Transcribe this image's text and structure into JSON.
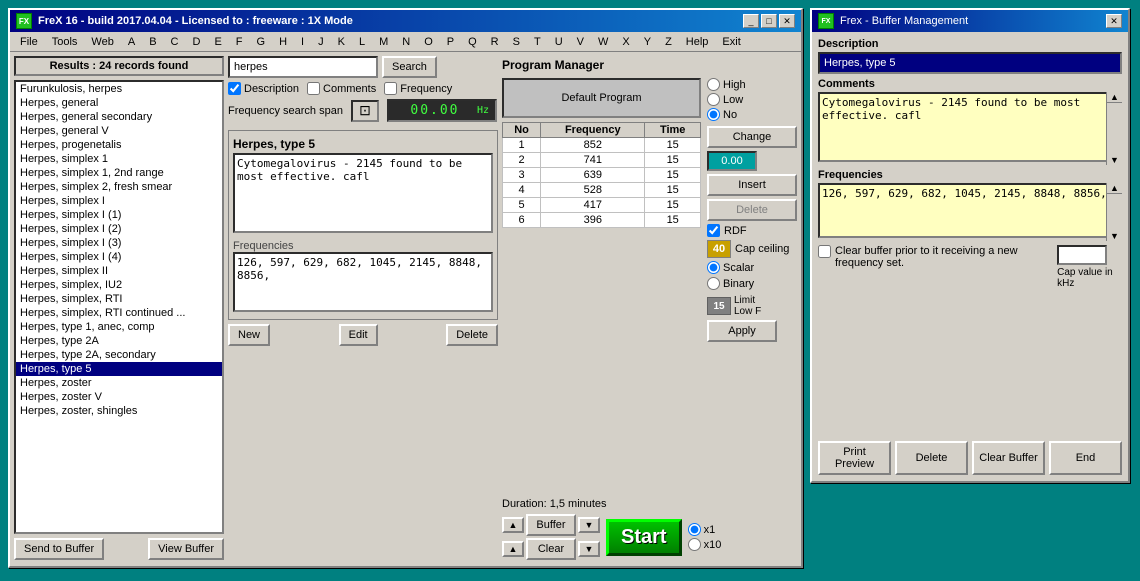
{
  "main_window": {
    "title": "FreX 16 - build 2017.04.04 - Licensed to : freeware  :  1X Mode",
    "icon": "FX",
    "menu_items": [
      "File",
      "Tools",
      "Web",
      "A",
      "B",
      "C",
      "D",
      "E",
      "F",
      "G",
      "H",
      "I",
      "J",
      "K",
      "L",
      "M",
      "N",
      "O",
      "P",
      "Q",
      "R",
      "S",
      "T",
      "U",
      "V",
      "W",
      "X",
      "Y",
      "Z",
      "Help",
      "Exit"
    ]
  },
  "results": {
    "header": "Results : 24 records found",
    "items": [
      "Furunkulosis, herpes",
      "Herpes, general",
      "Herpes, general secondary",
      "Herpes, general V",
      "Herpes, progenetalis",
      "Herpes, simplex 1",
      "Herpes, simplex 1, 2nd range",
      "Herpes, simplex 2, fresh smear",
      "Herpes, simplex I",
      "Herpes, simplex I (1)",
      "Herpes, simplex I (2)",
      "Herpes, simplex I (3)",
      "Herpes, simplex I (4)",
      "Herpes, simplex II",
      "Herpes, simplex, IU2",
      "Herpes, simplex, RTI",
      "Herpes, simplex, RTI continued ...",
      "Herpes, type 1, anec, comp",
      "Herpes, type 2A",
      "Herpes, type 2A, secondary",
      "Herpes, type 5",
      "Herpes, zoster",
      "Herpes, zoster V",
      "Herpes, zoster, shingles"
    ],
    "selected_index": 20,
    "buttons": {
      "send_to_buffer": "Send to Buffer",
      "view_buffer": "View Buffer"
    }
  },
  "search": {
    "input_value": "herpes",
    "button_label": "Search",
    "checkboxes": {
      "description": {
        "label": "Description",
        "checked": true
      },
      "comments": {
        "label": "Comments",
        "checked": false
      },
      "frequency": {
        "label": "Frequency",
        "checked": false
      }
    },
    "freq_span_label": "Frequency search span",
    "freq_display": "00.00",
    "hz_label": "Hz"
  },
  "selected_item": {
    "name": "Herpes, type 5",
    "description": "Cytomegalovirus - 2145 found to be most effective. cafl",
    "frequencies_label": "Frequencies",
    "frequencies": "126, 597, 629, 682, 1045, 2145, 8848, 8856,",
    "buttons": {
      "new": "New",
      "edit": "Edit",
      "delete": "Delete"
    }
  },
  "program_manager": {
    "title": "Program Manager",
    "default_program": "Default Program",
    "table": {
      "headers": [
        "No",
        "Frequency",
        "Time"
      ],
      "rows": [
        [
          "1",
          "852",
          "15"
        ],
        [
          "2",
          "741",
          "15"
        ],
        [
          "3",
          "639",
          "15"
        ],
        [
          "4",
          "528",
          "15"
        ],
        [
          "5",
          "417",
          "15"
        ],
        [
          "6",
          "396",
          "15"
        ]
      ]
    },
    "radio_group": {
      "label_high": "High",
      "label_low": "Low",
      "label_no": "No",
      "selected": "No"
    },
    "change_label": "Change",
    "change_value": "0.00",
    "insert_label": "Insert",
    "delete_label": "Delete",
    "rdf_label": "RDF",
    "rdf_checked": true,
    "cap_ceiling_label": "Cap ceiling",
    "cap_value": "40",
    "scalar_label": "Scalar",
    "binary_label": "Binary",
    "scalar_selected": true,
    "limit_label": "Limit",
    "low_f_label": "Low F",
    "limit_value": "15",
    "apply_label": "Apply",
    "duration_label": "Duration: 1,5 minutes",
    "buffer_label": "Buffer",
    "clear_label": "Clear",
    "start_label": "Start",
    "x1_label": "x1",
    "x10_label": "x10",
    "x1_selected": true
  },
  "buffer_window": {
    "title": "Frex - Buffer Management",
    "description_label": "Description",
    "description_value": "Herpes, type 5",
    "comments_label": "Comments",
    "comments_value": "Cytomegalovirus - 2145 found to be most effective. cafl",
    "frequencies_label": "Frequencies",
    "frequencies_value": "126, 597, 629, 682, 1045, 2145, 8848, 8856,",
    "clear_prior_label": "Clear buffer prior to it receiving a new frequency set.",
    "cap_value_label": "Cap value in kHz",
    "buttons": {
      "print_preview": "Print Preview",
      "delete": "Delete",
      "clear_buffer": "Clear Buffer",
      "end": "End"
    }
  }
}
